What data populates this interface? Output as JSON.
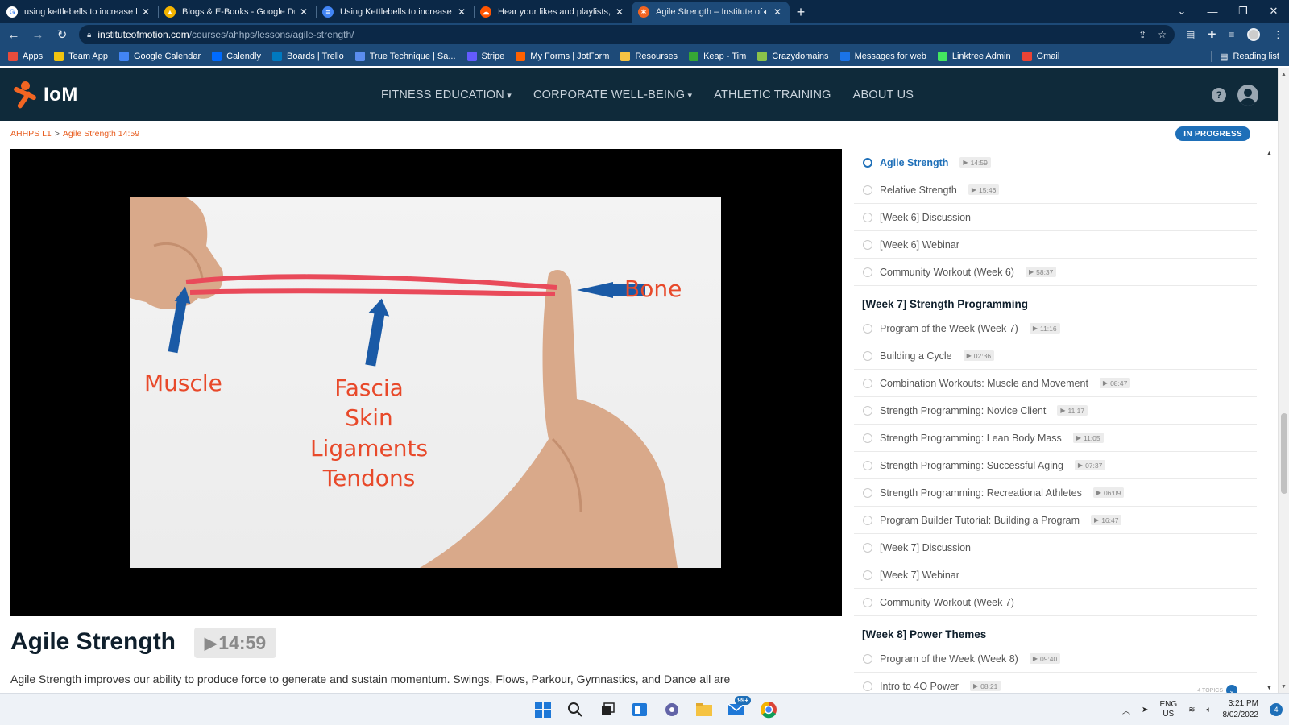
{
  "browser": {
    "tabs": [
      {
        "title": "using kettlebells to increase ham",
        "favicon_color": "#ffffff",
        "favicon_letter": "G",
        "active": false
      },
      {
        "title": "Blogs & E-Books - Google Drive",
        "favicon_color": "#f4b400",
        "favicon_letter": "▲",
        "active": false
      },
      {
        "title": "Using Kettlebells to increase ham",
        "favicon_color": "#4285f4",
        "favicon_letter": "≡",
        "active": false
      },
      {
        "title": "Hear your likes and playlists, and",
        "favicon_color": "#ff5500",
        "favicon_letter": "☁",
        "active": false
      },
      {
        "title": "Agile Strength – Institute of",
        "favicon_color": "#f26522",
        "favicon_letter": "✶",
        "active": true
      }
    ],
    "url_domain": "instituteofmotion.com",
    "url_path": "/courses/ahhps/lessons/agile-strength/",
    "bookmarks": [
      {
        "label": "Apps",
        "color": "#e74c3c"
      },
      {
        "label": "Team App",
        "color": "#f1c40f"
      },
      {
        "label": "Google Calendar",
        "color": "#4285f4"
      },
      {
        "label": "Calendly",
        "color": "#006bff"
      },
      {
        "label": "Boards | Trello",
        "color": "#0079bf"
      },
      {
        "label": "True Technique | Sa...",
        "color": "#5b8def"
      },
      {
        "label": "Stripe",
        "color": "#635bff"
      },
      {
        "label": "My Forms | JotForm",
        "color": "#ff6100"
      },
      {
        "label": "Resourses",
        "color": "#f6c343"
      },
      {
        "label": "Keap - Tim",
        "color": "#36a635"
      },
      {
        "label": "Crazydomains",
        "color": "#8bc34a"
      },
      {
        "label": "Messages for web",
        "color": "#1a73e8"
      },
      {
        "label": "Linktree Admin",
        "color": "#43e660"
      },
      {
        "label": "Gmail",
        "color": "#ea4335"
      }
    ],
    "reading_list": "Reading list"
  },
  "site": {
    "logo_text": "IoM",
    "nav": [
      "FITNESS EDUCATION",
      "CORPORATE WELL-BEING",
      "ATHLETIC TRAINING",
      "ABOUT US"
    ],
    "nav_dropdown": [
      true,
      true,
      false,
      false
    ]
  },
  "breadcrumb": {
    "course": "AHHPS L1",
    "separator": ">",
    "lesson": "Agile Strength 14:59"
  },
  "status_badge": "IN PROGRESS",
  "video": {
    "labels": {
      "bone": "Bone",
      "muscle": "Muscle",
      "fascia": "Fascia",
      "skin": "Skin",
      "ligaments": "Ligaments",
      "tendons": "Tendons"
    }
  },
  "lesson": {
    "title": "Agile Strength",
    "duration": "14:59",
    "description": "Agile Strength improves our ability to produce force to generate and sustain momentum. Swings, Flows, Parkour, Gymnastics, and Dance all are techniques/strategies that improve our agile strength."
  },
  "sidebar": {
    "week6_lessons": [
      {
        "title": "Agile Strength",
        "duration": "14:59",
        "current": true
      },
      {
        "title": "Relative Strength",
        "duration": "15:46"
      },
      {
        "title": "[Week 6] Discussion",
        "duration": ""
      },
      {
        "title": "[Week 6] Webinar",
        "duration": ""
      },
      {
        "title": "Community Workout (Week 6)",
        "duration": "58:37"
      }
    ],
    "week7_heading": "[Week 7] Strength Programming",
    "week7_lessons": [
      {
        "title": "Program of the Week (Week 7)",
        "duration": "11:16"
      },
      {
        "title": "Building a Cycle",
        "duration": "02:36"
      },
      {
        "title": "Combination Workouts: Muscle and Movement",
        "duration": "08:47"
      },
      {
        "title": "Strength Programming: Novice Client",
        "duration": "11:17"
      },
      {
        "title": "Strength Programming: Lean Body Mass",
        "duration": "11:05"
      },
      {
        "title": "Strength Programming: Successful Aging",
        "duration": "07:37"
      },
      {
        "title": "Strength Programming: Recreational Athletes",
        "duration": "06:09"
      },
      {
        "title": "Program Builder Tutorial: Building a Program",
        "duration": "16:47"
      },
      {
        "title": "[Week 7] Discussion",
        "duration": ""
      },
      {
        "title": "[Week 7] Webinar",
        "duration": ""
      },
      {
        "title": "Community Workout (Week 7)",
        "duration": ""
      }
    ],
    "week8_heading": "[Week 8] Power Themes",
    "week8_lessons": [
      {
        "title": "Program of the Week (Week 8)",
        "duration": "09:40"
      },
      {
        "title": "Intro to 4O Power",
        "duration": "08:21"
      }
    ],
    "topics_label": "4 TOPICS"
  },
  "taskbar": {
    "mail_badge": "99+",
    "lang_top": "ENG",
    "lang_bottom": "US",
    "time": "3:21 PM",
    "date": "8/02/2022",
    "notifications": "4"
  }
}
